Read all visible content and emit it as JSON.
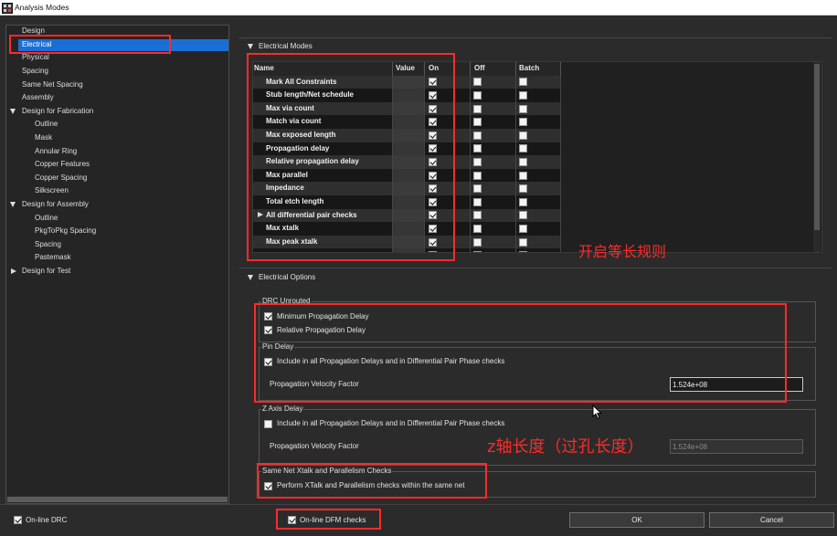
{
  "window": {
    "title": "Analysis Modes"
  },
  "tree": {
    "items": [
      {
        "label": "Design"
      },
      {
        "label": "Electrical",
        "selected": true
      },
      {
        "label": "Physical"
      },
      {
        "label": "Spacing"
      },
      {
        "label": "Same Net Spacing"
      },
      {
        "label": "Assembly"
      },
      {
        "label": "Design for Fabrication"
      },
      {
        "label": "Outline"
      },
      {
        "label": "Mask"
      },
      {
        "label": "Annular Ring"
      },
      {
        "label": "Copper Features"
      },
      {
        "label": "Copper Spacing"
      },
      {
        "label": "Silkscreen"
      },
      {
        "label": "Design for Assembly"
      },
      {
        "label": "Outline"
      },
      {
        "label": "PkgToPkg Spacing"
      },
      {
        "label": "Spacing"
      },
      {
        "label": "Pastemask"
      },
      {
        "label": "Design for Test"
      }
    ]
  },
  "electrical_modes": {
    "section_title": "Electrical Modes",
    "columns": [
      "Name",
      "Value",
      "On",
      "Off",
      "Batch"
    ],
    "rows": [
      {
        "name": "Mark All Constraints",
        "on": true,
        "off": false,
        "batch": false
      },
      {
        "name": "Stub length/Net schedule",
        "on": true,
        "off": false,
        "batch": false
      },
      {
        "name": "Max via count",
        "on": true,
        "off": false,
        "batch": false
      },
      {
        "name": "Match via count",
        "on": true,
        "off": false,
        "batch": false
      },
      {
        "name": "Max exposed length",
        "on": true,
        "off": false,
        "batch": false
      },
      {
        "name": "Propagation delay",
        "on": true,
        "off": false,
        "batch": false
      },
      {
        "name": "Relative propagation delay",
        "on": true,
        "off": false,
        "batch": false
      },
      {
        "name": "Max parallel",
        "on": true,
        "off": false,
        "batch": false
      },
      {
        "name": "Impedance",
        "on": true,
        "off": false,
        "batch": false
      },
      {
        "name": "Total etch length",
        "on": true,
        "off": false,
        "batch": false
      },
      {
        "name": "All differential pair checks",
        "expandable": true,
        "on": true,
        "off": false,
        "batch": false
      },
      {
        "name": "Max xtalk",
        "on": true,
        "off": false,
        "batch": false
      },
      {
        "name": "Max peak xtalk",
        "on": true,
        "off": false,
        "batch": false
      },
      {
        "name": "",
        "on": false,
        "off": false,
        "batch": false
      }
    ]
  },
  "electrical_options": {
    "section_title": "Electrical Options",
    "drc_unrouted": {
      "title": "DRC Unrouted",
      "minimum_propagation_delay": {
        "label": "Minimum Propagation Delay",
        "checked": true
      },
      "relative_propagation_delay": {
        "label": "Relative Propagation Delay",
        "checked": true
      }
    },
    "pin_delay": {
      "title": "Pin Delay",
      "include": {
        "label": "Include in all Propagation Delays and in Differential Pair Phase checks",
        "checked": true
      },
      "velocity_label": "Propagation Velocity Factor",
      "velocity_value": "1.524e+08"
    },
    "z_axis_delay": {
      "title": "Z Axis Delay",
      "include": {
        "label": "Include in all Propagation Delays and in Differential Pair Phase checks",
        "checked": false
      },
      "velocity_label": "Propagation Velocity Factor",
      "velocity_value": "1.524e+08",
      "enabled": false
    },
    "same_net_xtalk": {
      "title": "Same Net Xtalk and Parallelism Checks",
      "perform": {
        "label": "Perform XTalk and Parallelism checks within the same net",
        "checked": true
      }
    }
  },
  "footer": {
    "online_drc": {
      "label": "On-line DRC",
      "checked": true
    },
    "online_dfm": {
      "label": "On-line DFM checks",
      "checked": true
    },
    "ok_label": "OK",
    "cancel_label": "Cancel"
  },
  "annotations": {
    "equal_length_note": "开启等长规则",
    "z_axis_note": "z轴长度（过孔长度）"
  },
  "colors": {
    "selection": "#1a6fd6",
    "annotation": "#ff2a2a",
    "background": "#2b2b2b"
  }
}
